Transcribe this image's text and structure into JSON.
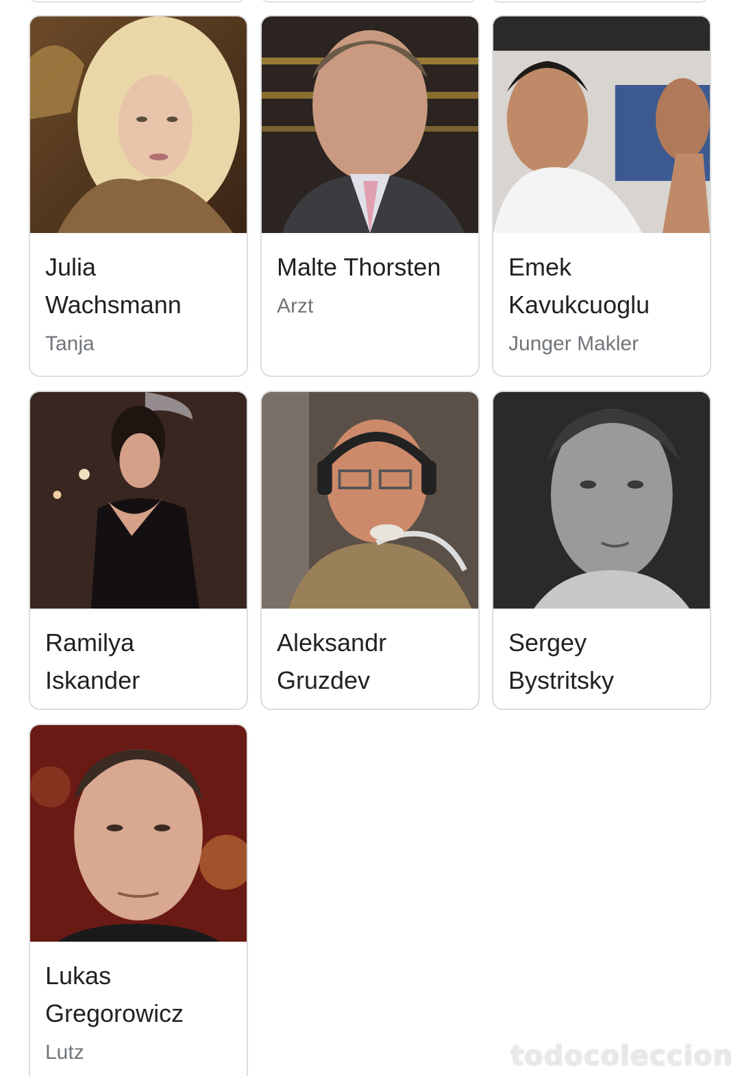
{
  "cast": [
    {
      "name": "Julia Wachsmann",
      "role": "Tanja"
    },
    {
      "name": "Malte Thorsten",
      "role": "Arzt"
    },
    {
      "name": "Emek Kavukcuoglu",
      "role": "Junger Makler"
    },
    {
      "name": "Ramilya Iskander",
      "role": ""
    },
    {
      "name": "Aleksandr Gruzdev",
      "role": ""
    },
    {
      "name": "Sergey Bystritsky",
      "role": ""
    },
    {
      "name": "Lukas Gregorowicz",
      "role": "Lutz"
    }
  ],
  "watermark": "todocoleccion"
}
